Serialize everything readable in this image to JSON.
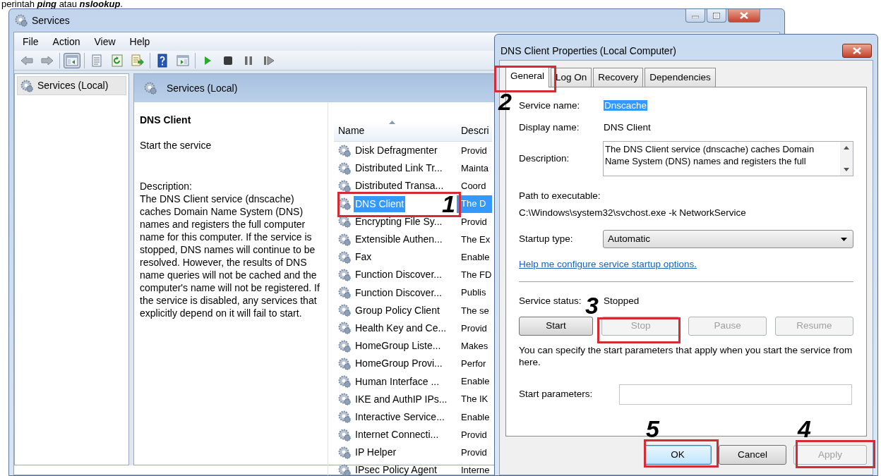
{
  "caption": "perintah **ping** atau **nslookup**.",
  "window": {
    "title": "Services"
  },
  "menu": [
    "File",
    "Action",
    "View",
    "Help"
  ],
  "toolbar": [
    {
      "kind": "back",
      "pressed": false
    },
    {
      "kind": "forward",
      "pressed": false
    },
    {
      "kind": "separator"
    },
    {
      "kind": "console-tree",
      "pressed": true
    },
    {
      "kind": "separator"
    },
    {
      "kind": "properties",
      "pressed": false
    },
    {
      "kind": "refresh",
      "pressed": false
    },
    {
      "kind": "export",
      "pressed": false
    },
    {
      "kind": "separator"
    },
    {
      "kind": "help",
      "pressed": false
    },
    {
      "kind": "action-pane",
      "pressed": false
    },
    {
      "kind": "separator"
    },
    {
      "kind": "play",
      "pressed": false
    },
    {
      "kind": "stop",
      "pressed": false
    },
    {
      "kind": "pause",
      "pressed": false
    },
    {
      "kind": "resume",
      "pressed": false
    }
  ],
  "tree": {
    "items": [
      {
        "label": "Services (Local)",
        "selected": true
      }
    ]
  },
  "pane": {
    "title": "Services (Local)"
  },
  "details": {
    "title": "DNS Client",
    "action_link": "Start",
    "action_text": "the service",
    "description_label": "Description:",
    "description": "The DNS Client service (dnscache) caches Domain Name System (DNS) names and registers the full computer name for this computer. If the service is stopped, DNS names will continue to be resolved. However, the results of DNS name queries will not be cached and the computer's name will not be registered. If the service is disabled, any services that explicitly depend on it will fail to start."
  },
  "list": {
    "columns": [
      "Name",
      "Descri"
    ],
    "rows": [
      {
        "name": "Disk Defragmenter",
        "description": "Provid",
        "selected": false
      },
      {
        "name": "Distributed Link Tr...",
        "description": "Mainta",
        "selected": false
      },
      {
        "name": "Distributed Transa...",
        "description": "Coord",
        "selected": false
      },
      {
        "name": "DNS Client",
        "description": "The D",
        "selected": true
      },
      {
        "name": "Encrypting File Sy...",
        "description": "Provid",
        "selected": false
      },
      {
        "name": "Extensible Authen...",
        "description": "The Ex",
        "selected": false
      },
      {
        "name": "Fax",
        "description": "Enable",
        "selected": false
      },
      {
        "name": "Function Discover...",
        "description": "The FD",
        "selected": false
      },
      {
        "name": "Function Discover...",
        "description": "Publis",
        "selected": false
      },
      {
        "name": "Group Policy Client",
        "description": "The se",
        "selected": false
      },
      {
        "name": "Health Key and Ce...",
        "description": "Provid",
        "selected": false
      },
      {
        "name": "HomeGroup Liste...",
        "description": "Makes",
        "selected": false
      },
      {
        "name": "HomeGroup Provi...",
        "description": "Perfor",
        "selected": false
      },
      {
        "name": "Human Interface ...",
        "description": "Enable",
        "selected": false
      },
      {
        "name": "IKE and AuthIP IPs...",
        "description": "The IK",
        "selected": false
      },
      {
        "name": "Interactive Service...",
        "description": "Enable",
        "selected": false
      },
      {
        "name": "Internet Connecti...",
        "description": "Provid",
        "selected": false
      },
      {
        "name": "IP Helper",
        "description": "Provid",
        "selected": false
      },
      {
        "name": "IPsec Policy Agent",
        "description": "Interne",
        "selected": false
      }
    ]
  },
  "dialog": {
    "title": "DNS Client Properties (Local Computer)",
    "tabs": [
      {
        "label": "General",
        "selected": true
      },
      {
        "label": "Log On",
        "selected": false
      },
      {
        "label": "Recovery",
        "selected": false
      },
      {
        "label": "Dependencies",
        "selected": false
      }
    ],
    "service_name_label": "Service name:",
    "service_name": "Dnscache",
    "display_name_label": "Display name:",
    "display_name": "DNS Client",
    "description_label": "Description:",
    "description": "The DNS Client service (dnscache) caches Domain Name System (DNS) names and registers the full",
    "path_label": "Path to executable:",
    "path": "C:\\Windows\\system32\\svchost.exe -k NetworkService",
    "startup_label": "Startup type:",
    "startup_value": "Automatic",
    "help_link": "Help me configure service startup options.",
    "status_label": "Service status:",
    "status_value": "Stopped",
    "service_buttons": [
      {
        "label": "Start",
        "disabled": false
      },
      {
        "label": "Stop",
        "disabled": true
      },
      {
        "label": "Pause",
        "disabled": true
      },
      {
        "label": "Resume",
        "disabled": true
      }
    ],
    "note": "You can specify the start parameters that apply when you start the service from here.",
    "params_label": "Start parameters:",
    "buttons": [
      {
        "label": "OK",
        "disabled": false,
        "default": true
      },
      {
        "label": "Cancel",
        "disabled": false,
        "default": false
      },
      {
        "label": "Apply",
        "disabled": true,
        "default": false
      }
    ]
  },
  "annotations": [
    {
      "number": "1"
    },
    {
      "number": "2"
    },
    {
      "number": "3"
    },
    {
      "number": "4"
    },
    {
      "number": "5"
    }
  ]
}
